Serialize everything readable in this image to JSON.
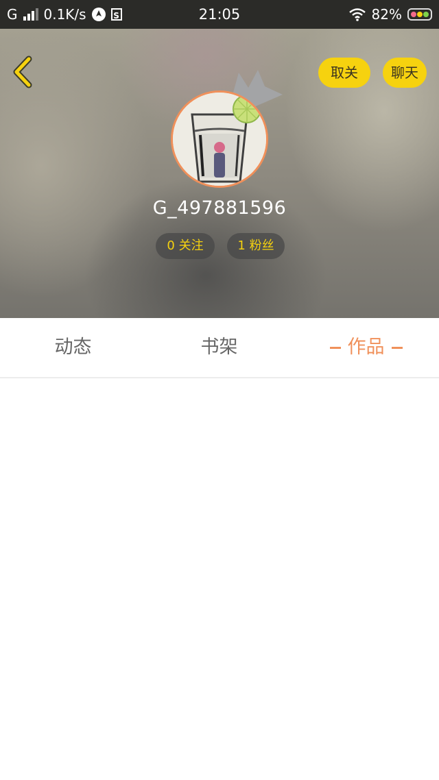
{
  "status_bar": {
    "network": "G",
    "speed": "0.1K/s",
    "time": "21:05",
    "battery": "82%",
    "icons": [
      "signal-icon",
      "navigation-icon",
      "s-app-icon",
      "wifi-icon",
      "battery-icon"
    ]
  },
  "header": {
    "unfollow_label": "取关",
    "chat_label": "聊天",
    "username": "G_497881596",
    "follow_stat": "0 关注",
    "fans_stat": "1 粉丝",
    "accent_color": "#f6d20f",
    "avatar_border_color": "#f0905a"
  },
  "tabs": [
    {
      "label": "动态",
      "active": false
    },
    {
      "label": "书架",
      "active": false
    },
    {
      "label": "作品",
      "active": true
    }
  ],
  "active_tab_color": "#f0905a"
}
